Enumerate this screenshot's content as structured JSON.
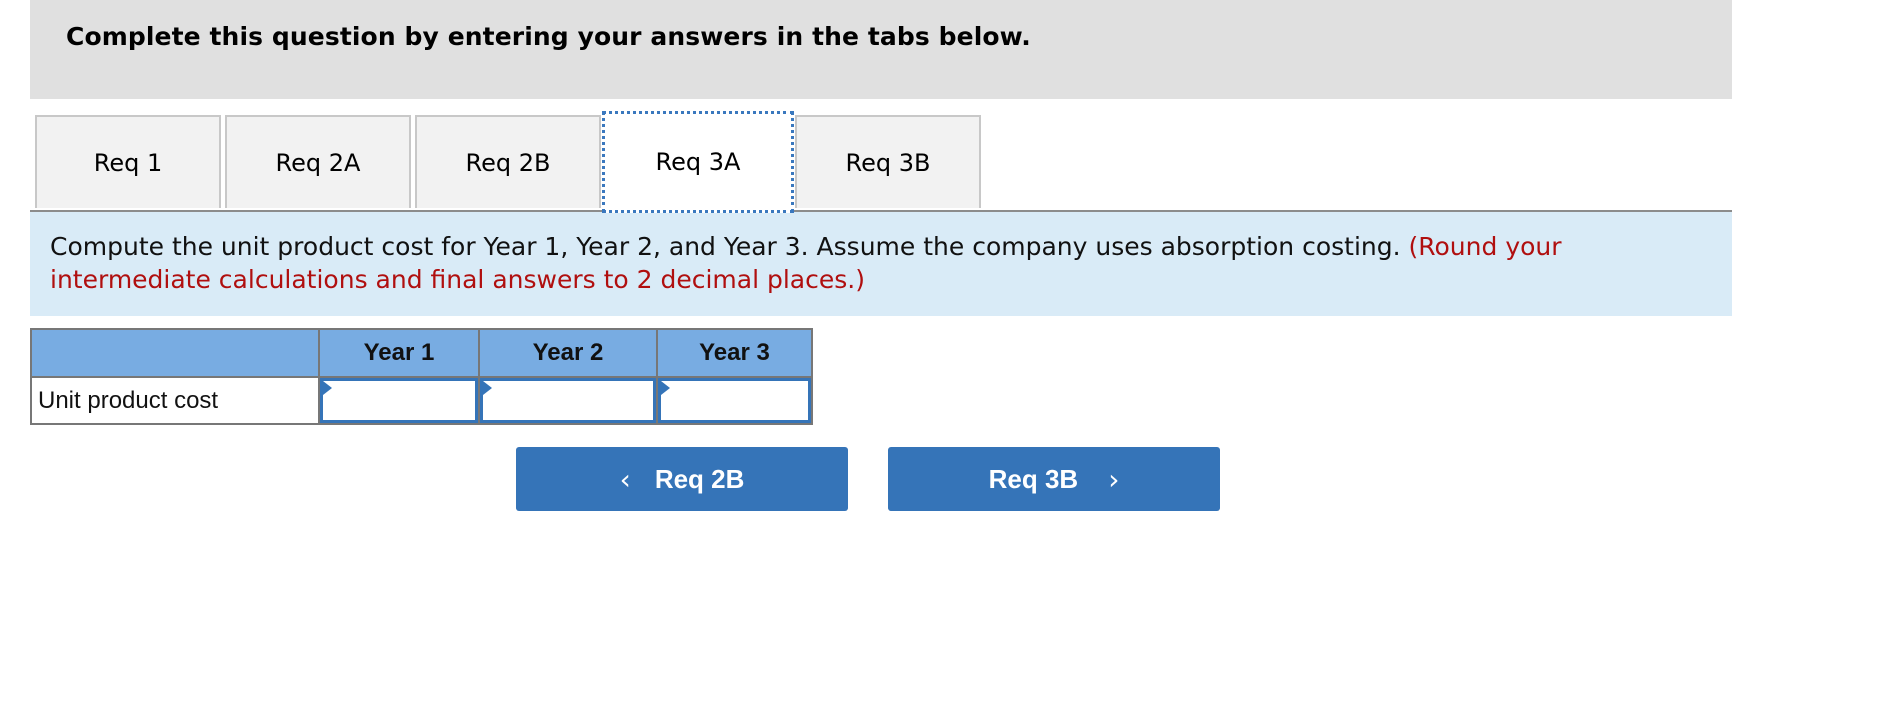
{
  "header": {
    "title": "Complete this question by entering your answers in the tabs below."
  },
  "tabs": [
    {
      "label": "Req 1",
      "active": false
    },
    {
      "label": "Req 2A",
      "active": false
    },
    {
      "label": "Req 2B",
      "active": false
    },
    {
      "label": "Req 3A",
      "active": true
    },
    {
      "label": "Req 3B",
      "active": false
    }
  ],
  "instructions": {
    "text": "Compute the unit product cost for Year 1, Year 2, and Year 3. Assume the company uses absorption costing.",
    "note": "(Round your intermediate calculations and final answers to 2 decimal places.)"
  },
  "table": {
    "columns": [
      "",
      "Year 1",
      "Year 2",
      "Year 3"
    ],
    "rows": [
      {
        "label": "Unit product cost",
        "values": [
          "",
          "",
          ""
        ]
      }
    ]
  },
  "navigation": {
    "prev_label": "Req 2B",
    "next_label": "Req 3B",
    "prev_icon": "chevron-left-icon",
    "next_icon": "chevron-right-icon"
  },
  "colors": {
    "accent": "#3574b8",
    "header_bg": "#e0e0e0",
    "instructions_bg": "#d9ebf7",
    "table_header_bg": "#78ace2",
    "note_red": "#b00f0f"
  }
}
